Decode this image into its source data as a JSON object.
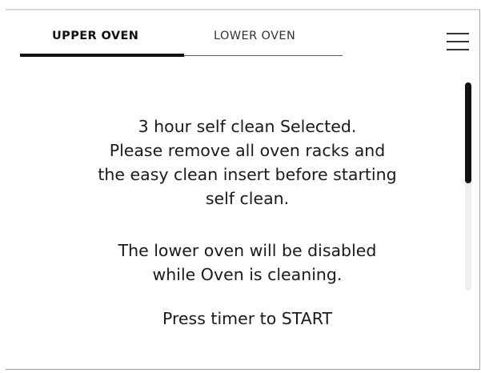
{
  "tabs": [
    {
      "label": "UPPER OVEN",
      "active": true
    },
    {
      "label": "LOWER OVEN",
      "active": false
    }
  ],
  "menu": {
    "icon": "hamburger-menu-icon"
  },
  "message": {
    "line1": "3 hour self clean Selected.",
    "line2": "Please remove all oven racks and",
    "line3": "the easy clean insert before starting",
    "line4": "self clean.",
    "line5": "The lower oven will be disabled",
    "line6": "while Oven is cleaning.",
    "line7": "Press timer to START"
  },
  "colors": {
    "text": "#1a1a1a",
    "active_tab_underline": "#111111",
    "scroll_thumb": "#111111",
    "scroll_track": "#eeeeee"
  }
}
